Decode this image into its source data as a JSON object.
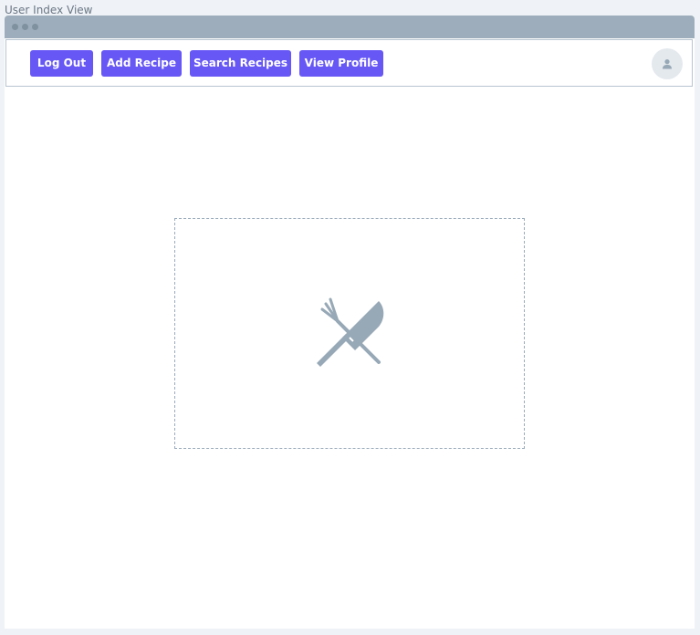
{
  "view_title": "User Index View",
  "nav": {
    "log_out_label": "Log Out",
    "add_recipe_label": "Add Recipe",
    "search_recipes_label": "Search Recipes",
    "view_profile_label": "View Profile"
  },
  "icons": {
    "avatar": "user-icon",
    "placeholder": "fork-knife-icon"
  },
  "colors": {
    "primary_button": "#6757f5",
    "titlebar": "#9dadbb",
    "icon_gray": "#97a8b6"
  }
}
